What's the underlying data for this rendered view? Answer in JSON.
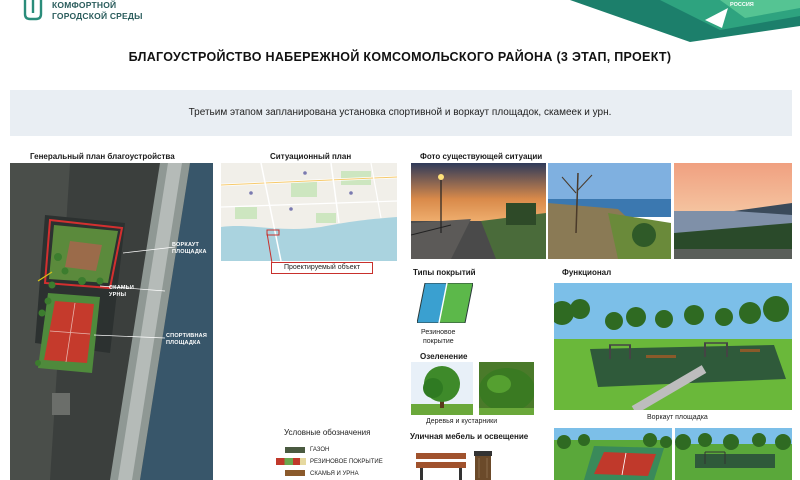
{
  "header": {
    "logo_line1": "КОМФОРТНОЙ",
    "logo_line2": "ГОРОДСКОЙ СРЕДЫ",
    "corner_text": "РОССИЯ"
  },
  "title": "БЛАГОУСТРОЙСТВО НАБЕРЕЖНОЙ КОМСОМОЛЬСКОГО РАЙОНА (3 ЭТАП, ПРОЕКТ)",
  "intro": "Третьим этапом запланирована установка спортивной и воркаут площадок, скамеек и урн.",
  "general_plan": {
    "label": "Генеральный план благоустройства",
    "callouts": {
      "workout_1": "ВОРКАУТ",
      "workout_2": "ПЛОЩАДКА",
      "bench_1": "СКАМЬИ",
      "bench_2": "УРНЫ",
      "sport_1": "СПОРТИВНАЯ",
      "sport_2": "ПЛОЩАДКА"
    }
  },
  "situation_plan": {
    "label": "Ситуационный план",
    "projected_object": "Проектируемый объект"
  },
  "legend": {
    "title": "Условные обозначения",
    "items": [
      {
        "text": "ГАЗОН",
        "color": "#6aa84f"
      },
      {
        "text": "РЕЗИНОВОЕ ПОКРЫТИЕ",
        "color": "#c0392b"
      },
      {
        "text": "СКАМЬЯ И УРНА",
        "color": "#8b5a2b"
      }
    ]
  },
  "photos": {
    "label": "Фото существующей ситуации"
  },
  "coverings": {
    "label": "Типы покрытий",
    "rubber_1": "Резиновое",
    "rubber_2": "покрытие"
  },
  "landscaping": {
    "label": "Озеленение",
    "caption": "Деревья и кустарники"
  },
  "furniture": {
    "label": "Уличная мебель и освещение"
  },
  "functional": {
    "label": "Функционал",
    "caption": "Воркаут площадка"
  },
  "colors": {
    "accent_green": "#2e9a6b",
    "brand_teal": "#2a5c5c",
    "band": "#e9eef3",
    "rubber_red": "#c0392b"
  }
}
